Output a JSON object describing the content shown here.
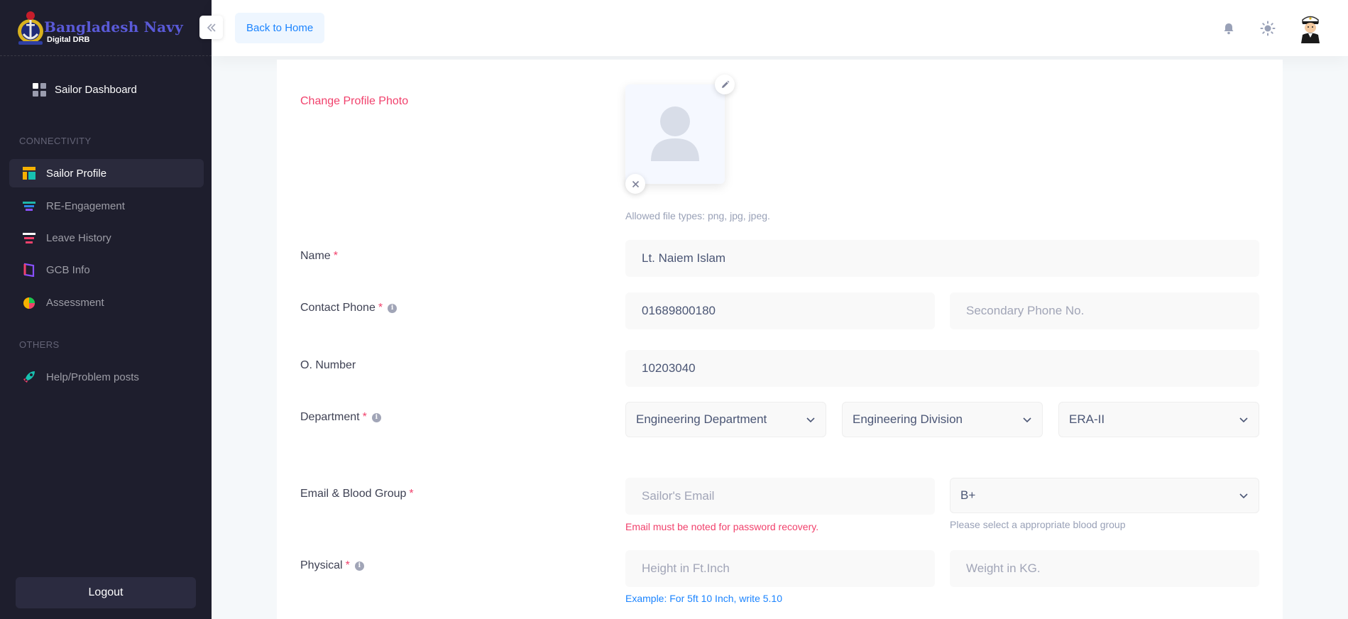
{
  "brand": {
    "name": "Bangladesh Navy",
    "subtitle": "Digital DRB"
  },
  "sidebar": {
    "dashboard_label": "Sailor Dashboard",
    "sections": [
      {
        "label": "CONNECTIVITY"
      },
      {
        "label": "OTHERS"
      }
    ],
    "items": [
      {
        "label": "Sailor Profile",
        "active": true,
        "icon": "profile-layout-icon"
      },
      {
        "label": "RE-Engagement",
        "active": false,
        "icon": "layers-icon"
      },
      {
        "label": "Leave History",
        "active": false,
        "icon": "list-icon"
      },
      {
        "label": "GCB Info",
        "active": false,
        "icon": "book-icon"
      },
      {
        "label": "Assessment",
        "active": false,
        "icon": "pie-chart-icon"
      },
      {
        "label": "Help/Problem posts",
        "active": false,
        "icon": "rocket-icon"
      }
    ],
    "logout_label": "Logout"
  },
  "header": {
    "back_label": "Back to Home",
    "icons": [
      "bell-icon",
      "sun-icon",
      "user-avatar"
    ]
  },
  "form": {
    "photo": {
      "label": "Change Profile Photo",
      "allowed_hint": "Allowed file types: png, jpg, jpeg."
    },
    "name": {
      "label": "Name",
      "required": "*",
      "value": "Lt. Naiem Islam"
    },
    "contact": {
      "label": "Contact Phone",
      "required": "*",
      "primary_value": "01689800180",
      "secondary_placeholder": "Secondary Phone No."
    },
    "o_number": {
      "label": "O. Number",
      "value": "10203040"
    },
    "department": {
      "label": "Department",
      "required": "*",
      "department_value": "Engineering Department",
      "division_value": "Engineering Division",
      "rank_value": "ERA-II"
    },
    "email_blood": {
      "label": "Email & Blood Group",
      "required": "*",
      "email_placeholder": "Sailor's Email",
      "email_hint": "Email must be noted for password recovery.",
      "blood_value": "B+",
      "blood_hint": "Please select a appropriate blood group"
    },
    "physical": {
      "label": "Physical",
      "required": "*",
      "height_placeholder": "Height in Ft.Inch",
      "weight_placeholder": "Weight in KG.",
      "height_hint": "Example: For 5ft 10 Inch, write 5.10"
    }
  },
  "colors": {
    "sidebar_bg": "#1e1e2d",
    "accent_blue": "#1b84ff",
    "danger": "#f1416c",
    "brand_purple": "#5a5ad8"
  }
}
